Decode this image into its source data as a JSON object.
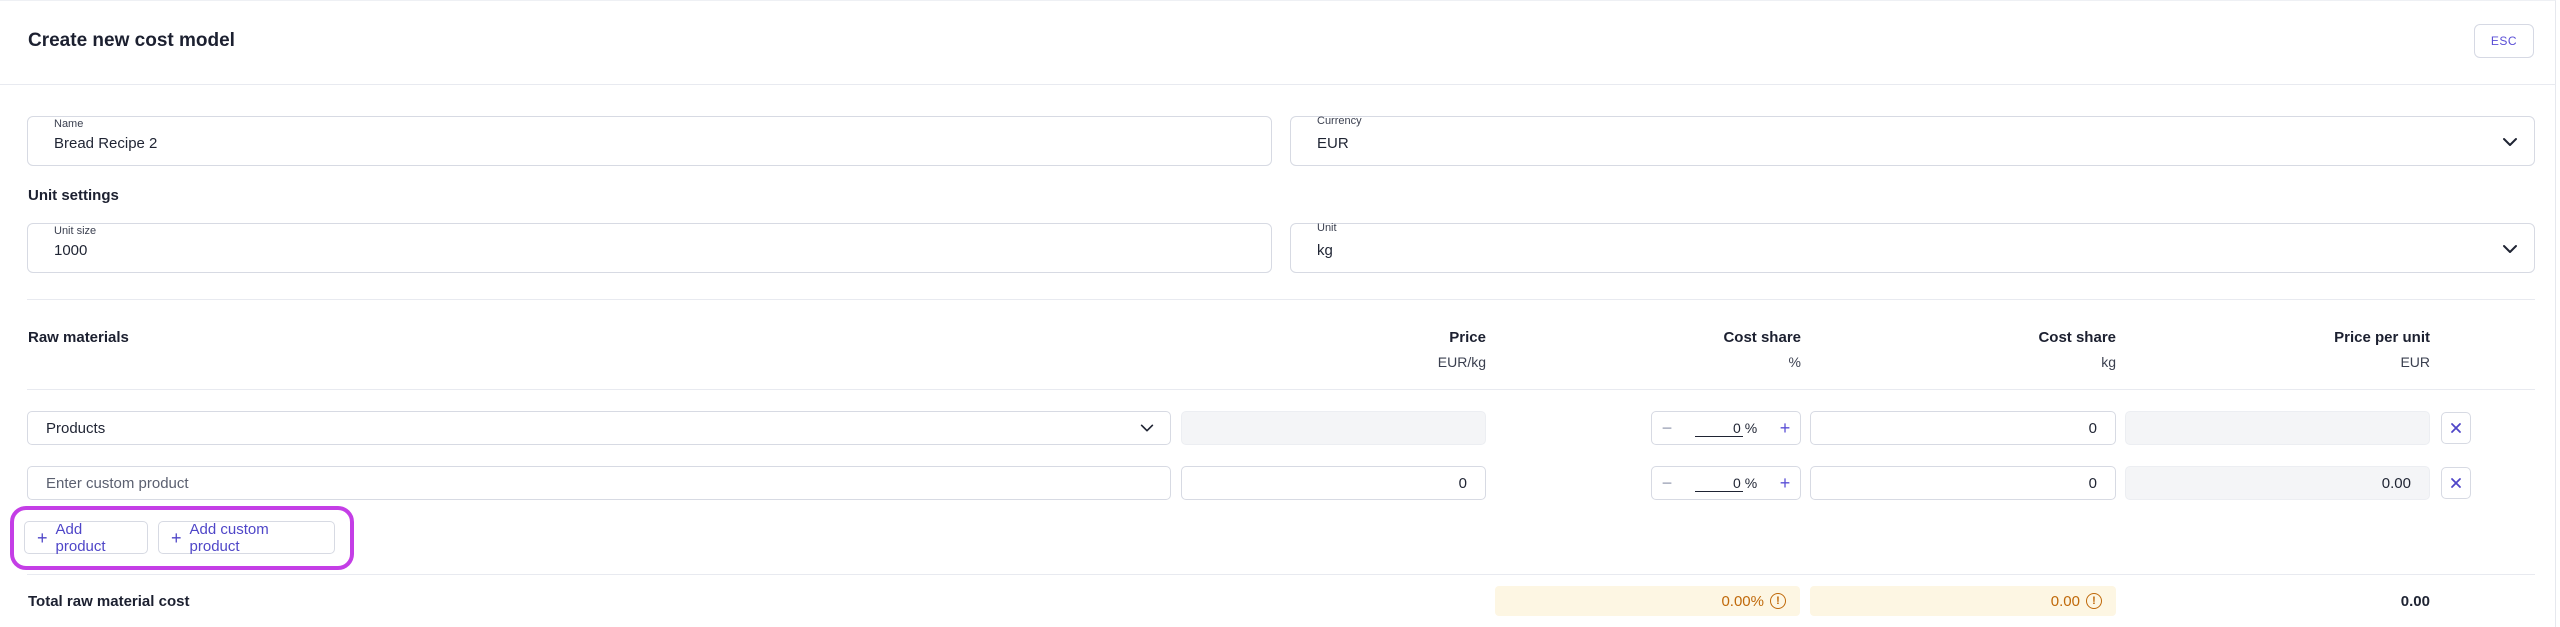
{
  "dialog": {
    "title": "Create new cost model",
    "esc_label": "ESC"
  },
  "general": {
    "name_label": "Name",
    "name_value": "Bread Recipe 2",
    "currency_label": "Currency",
    "currency_value": "EUR"
  },
  "unit_settings": {
    "heading": "Unit settings",
    "unit_size_label": "Unit size",
    "unit_size_value": "1000",
    "unit_label": "Unit",
    "unit_value": "kg"
  },
  "raw_materials": {
    "heading": "Raw materials",
    "columns": [
      {
        "title": "Price",
        "sub": "EUR/kg"
      },
      {
        "title": "Cost share",
        "sub": "%"
      },
      {
        "title": "Cost share",
        "sub": "kg"
      },
      {
        "title": "Price per unit",
        "sub": "EUR"
      }
    ],
    "rows": [
      {
        "product_placeholder": "Products",
        "price": "",
        "share_pct": "0",
        "pct_sign": "%",
        "share_kg": "0",
        "price_per_unit": ""
      },
      {
        "product_placeholder": "Enter custom product",
        "price": "0",
        "share_pct": "0",
        "pct_sign": "%",
        "share_kg": "0",
        "price_per_unit": "0.00"
      }
    ],
    "add_product_label": "Add product",
    "add_custom_product_label": "Add custom product"
  },
  "totals": {
    "label": "Total raw material cost",
    "share_pct": "0.00%",
    "share_kg": "0.00",
    "price_per_unit": "0.00"
  },
  "colors": {
    "accent": "#5a4fd6",
    "highlight": "#c43ee6",
    "warning": "#c0690a",
    "warning_bg": "#fdf6e3"
  },
  "icons": {
    "dropdown": "chevron-down-icon",
    "remove": "close-icon",
    "add": "plus-icon",
    "minus": "minus-icon",
    "warning": "info-circle-icon"
  }
}
